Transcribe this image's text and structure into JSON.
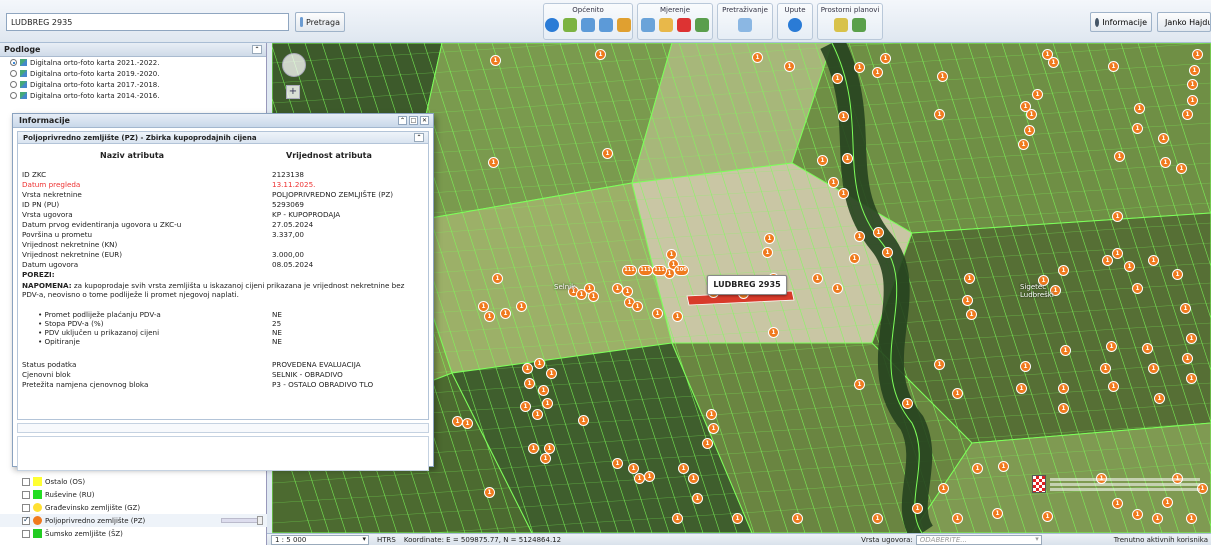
{
  "search": {
    "value": "LUDBREG 2935",
    "button_label": "Pretraga"
  },
  "toolbar": {
    "groups": [
      {
        "label": "Općenito"
      },
      {
        "label": "Mjerenje"
      },
      {
        "label": "Pretraživanje"
      },
      {
        "label": "Upute"
      },
      {
        "label": "Prostorni planovi"
      }
    ],
    "info_label": "Informacije",
    "user_label": "Janko Hajdu"
  },
  "left_panel": {
    "podloge_title": "Podloge",
    "base_layers": [
      {
        "label": "Digitalna orto-foto karta 2021.-2022.",
        "selected": true
      },
      {
        "label": "Digitalna orto-foto karta 2019.-2020.",
        "selected": false
      },
      {
        "label": "Digitalna orto-foto karta 2017.-2018.",
        "selected": false
      },
      {
        "label": "Digitalna orto-foto karta 2014.-2016.",
        "selected": false
      }
    ],
    "overlay_layers": [
      {
        "label": "Ostalo (OS)",
        "color": "#ffff33",
        "checked": false,
        "shape": "square"
      },
      {
        "label": "Ruševine (RU)",
        "color": "#22dd22",
        "checked": false,
        "shape": "square"
      },
      {
        "label": "Građevinsko zemljište (GZ)",
        "color": "#ffe033",
        "checked": false,
        "shape": "circle"
      },
      {
        "label": "Poljoprivredno zemljište (PZ)",
        "color": "#f07a1e",
        "checked": true,
        "shape": "circle"
      },
      {
        "label": "Šumsko zemljište (ŠZ)",
        "color": "#22cc22",
        "checked": false,
        "shape": "square"
      }
    ]
  },
  "info_window": {
    "title": "Informacije",
    "subtitle": "Poljoprivredno zemljište (PZ) - Zbirka kupoprodajnih cijena",
    "col_name": "Naziv atributa",
    "col_value": "Vrijednost atributa",
    "rows": [
      {
        "key": "ID ZKC",
        "value": "2123138"
      },
      {
        "key": "Datum pregleda",
        "value": "13.11.2025."
      },
      {
        "key": "Vrsta nekretnine",
        "value": "POLJOPRIVREDNO ZEMLJIŠTE (PZ)"
      },
      {
        "key": "ID PN (PU)",
        "value": "5293069"
      },
      {
        "key": "Vrsta ugovora",
        "value": "KP - KUPOPRODAJA"
      },
      {
        "key": "Datum prvog evidentiranja ugovora u ZKC-u",
        "value": "27.05.2024"
      },
      {
        "key": "Površina u prometu",
        "value": "3.337,00"
      },
      {
        "key": "Vrijednost nekretnine (KN)",
        "value": ""
      },
      {
        "key": "Vrijednost nekretnine (EUR)",
        "value": "3.000,00"
      },
      {
        "key": "Datum ugovora",
        "value": "08.05.2024"
      }
    ],
    "porezi_label": "POREZI:",
    "napomena_label": "NAPOMENA:",
    "napomena_text": " za kupoprodaje svih vrsta zemljišta u iskazanoj cijeni prikazana je vrijednost nekretnine bez PDV-a, neovisno o tome podliježe li promet njegovoj naplati.",
    "tax_rows": [
      {
        "key": "• Promet podliježe plaćanju PDV-a",
        "value": "NE"
      },
      {
        "key": "• Stopa PDV-a (%)",
        "value": "25"
      },
      {
        "key": "• PDV uključen u prikazanoj cijeni",
        "value": "NE"
      },
      {
        "key": "• Opitiranje",
        "value": "NE"
      }
    ],
    "status_rows": [
      {
        "key": "Status podatka",
        "value": "PROVEDENA EVALUACIJA"
      },
      {
        "key": "Cjenovni blok",
        "value": "SELNIK - OBRADIVO"
      },
      {
        "key": "Pretežita namjena cjenovnog bloka",
        "value": "P3 - OSTALO OBRADIVO TLO"
      }
    ]
  },
  "map": {
    "selected_label": "LUDBREG 2935",
    "place_labels": [
      "Selnik",
      "Sigetec Ludbreški"
    ],
    "marker_default": "1",
    "cluster_labels": [
      "111",
      "111",
      "111",
      "100"
    ]
  },
  "statusbar": {
    "scale": "1 : 5 000",
    "crs": "HTRS",
    "coords": "Koordinate: E = 509875.77, N = 5124864.12",
    "ugovor_label": "Vrsta ugovora:",
    "ugovor_placeholder": "ODABERITE...",
    "users_label": "Trenutno aktivnih korisnika"
  },
  "colors": {
    "marker": "#f07a1e",
    "parcel_lines": "#7dff5a",
    "selected_parcel": "#d83a2a",
    "highlight_red": "#e33333"
  }
}
